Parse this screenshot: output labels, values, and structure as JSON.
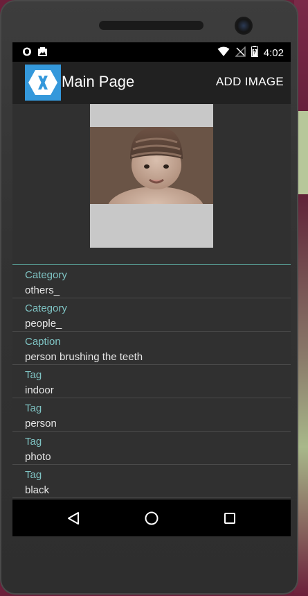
{
  "status_bar": {
    "time": "4:02",
    "icons_left": [
      "shield-icon",
      "photo-notification-icon"
    ],
    "icons_right": [
      "wifi-icon",
      "no-signal-icon",
      "battery-icon"
    ]
  },
  "app_bar": {
    "title": "Main Page",
    "action_label": "ADD IMAGE",
    "icon": "xamarin-logo-icon",
    "icon_color": "#3498db"
  },
  "image": {
    "description_icon": "baby-photo"
  },
  "results": [
    {
      "key": "Category",
      "value": "others_"
    },
    {
      "key": "Category",
      "value": "people_"
    },
    {
      "key": "Caption",
      "value": "person brushing the teeth"
    },
    {
      "key": "Tag",
      "value": "indoor"
    },
    {
      "key": "Tag",
      "value": "person"
    },
    {
      "key": "Tag",
      "value": "photo"
    },
    {
      "key": "Tag",
      "value": "black"
    }
  ],
  "colors": {
    "key_text": "#7fc4c4",
    "divider_accent": "#5aa59c",
    "background": "#303030"
  },
  "nav_bar": {
    "buttons": [
      "back-icon",
      "home-icon",
      "recents-icon"
    ]
  }
}
